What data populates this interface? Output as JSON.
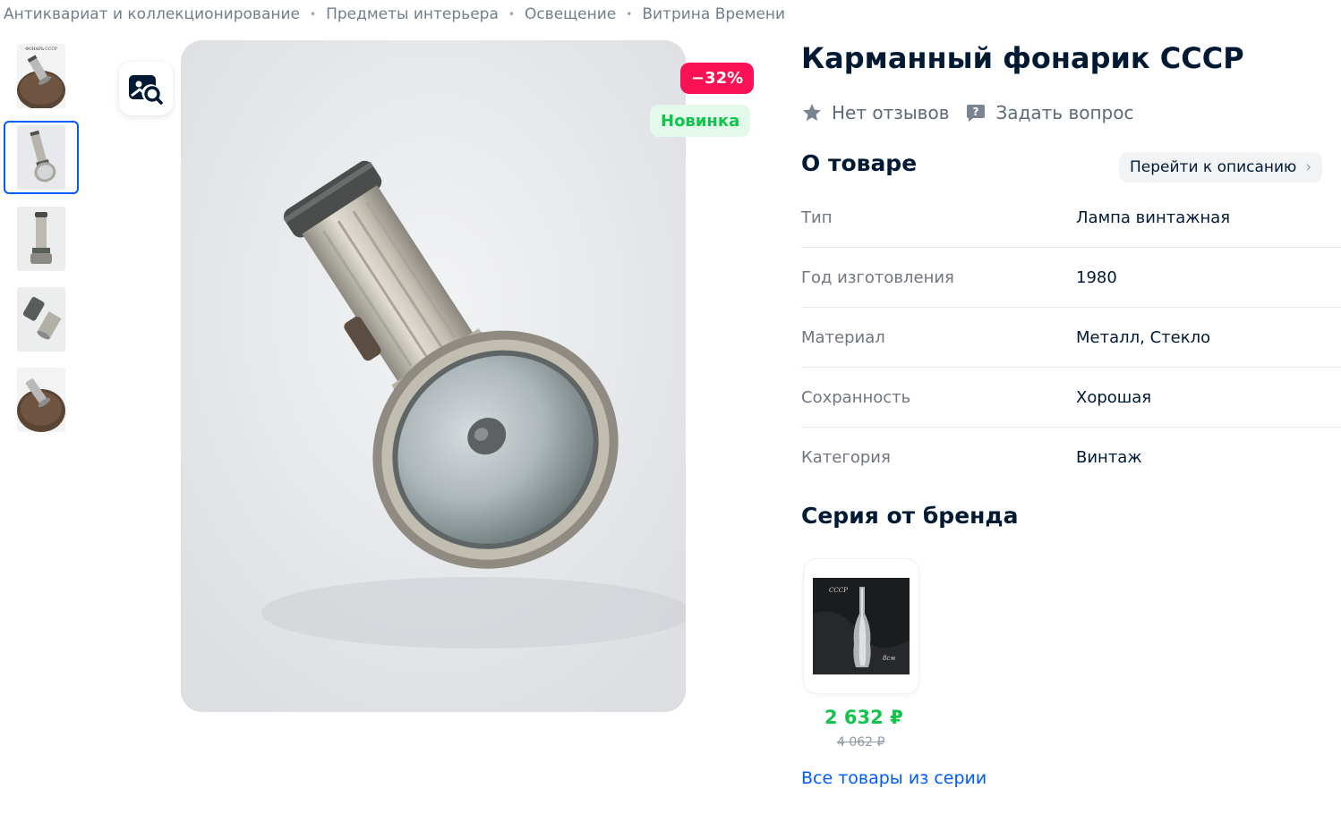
{
  "breadcrumb": [
    "Антиквариат и коллекционирование",
    "Предметы интерьера",
    "Освещение",
    "Витрина Времени"
  ],
  "product": {
    "title": "Карманный фонарик СССР",
    "reviews": "Нет отзывов",
    "ask": "Задать вопрос",
    "discount_badge": "−32%",
    "new_badge": "Новинка"
  },
  "thumbs": {
    "label_1": "ФОНАРЬ СССР",
    "selected_index": 2,
    "count": 5
  },
  "about": {
    "heading": "О товаре",
    "goto_label": "Перейти к описанию",
    "specs": [
      {
        "k": "Тип",
        "v": "Лампа винтажная"
      },
      {
        "k": "Год изготовления",
        "v": "1980"
      },
      {
        "k": "Материал",
        "v": "Металл, Стекло"
      },
      {
        "k": "Сохранность",
        "v": "Хорошая"
      },
      {
        "k": "Категория",
        "v": "Винтаж"
      }
    ]
  },
  "series": {
    "heading": "Серия от бренда",
    "card": {
      "img_label_top": "СССР",
      "img_label_bottom": "8см",
      "price": "2 632 ₽",
      "old_price": "4 062 ₽"
    },
    "all_link": "Все товары из серии"
  },
  "colors": {
    "accent": "#005bff",
    "discount": "#f91155",
    "new": "#10c44c",
    "text": "#001a34",
    "muted": "#70757f"
  }
}
